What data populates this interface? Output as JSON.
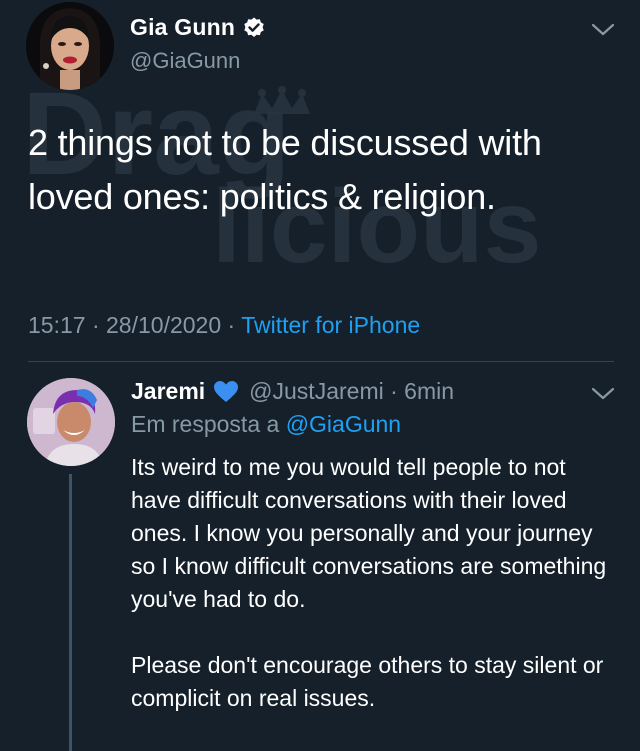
{
  "main_tweet": {
    "author_name": "Gia Gunn",
    "author_handle": "@GiaGunn",
    "text": "2 things not to be discussed with loved ones: politics & religion.",
    "time": "15:17",
    "date": "28/10/2020",
    "source": "Twitter for iPhone"
  },
  "watermark": {
    "line1": "Drag",
    "line2": "licious"
  },
  "reply": {
    "author_name": "Jaremi",
    "author_handle": "@JustJaremi",
    "age": "6min",
    "replying_to_label": "Em resposta a",
    "replying_to_handle": "@GiaGunn",
    "paragraph1": "Its weird to me you would tell people to not have difficult conversations with their loved ones. I know you personally and your journey so I know difficult conversations are something you've had to do.",
    "paragraph2": "Please don't encourage others to stay silent or complicit on real issues."
  },
  "icons": {
    "verified": "verified-badge-icon",
    "heart": "blue-heart-icon",
    "menu": "chevron-down-icon"
  },
  "colors": {
    "background": "#15202b",
    "secondary_text": "#8899a6",
    "accent": "#1da1f2",
    "divider": "#38444d"
  }
}
